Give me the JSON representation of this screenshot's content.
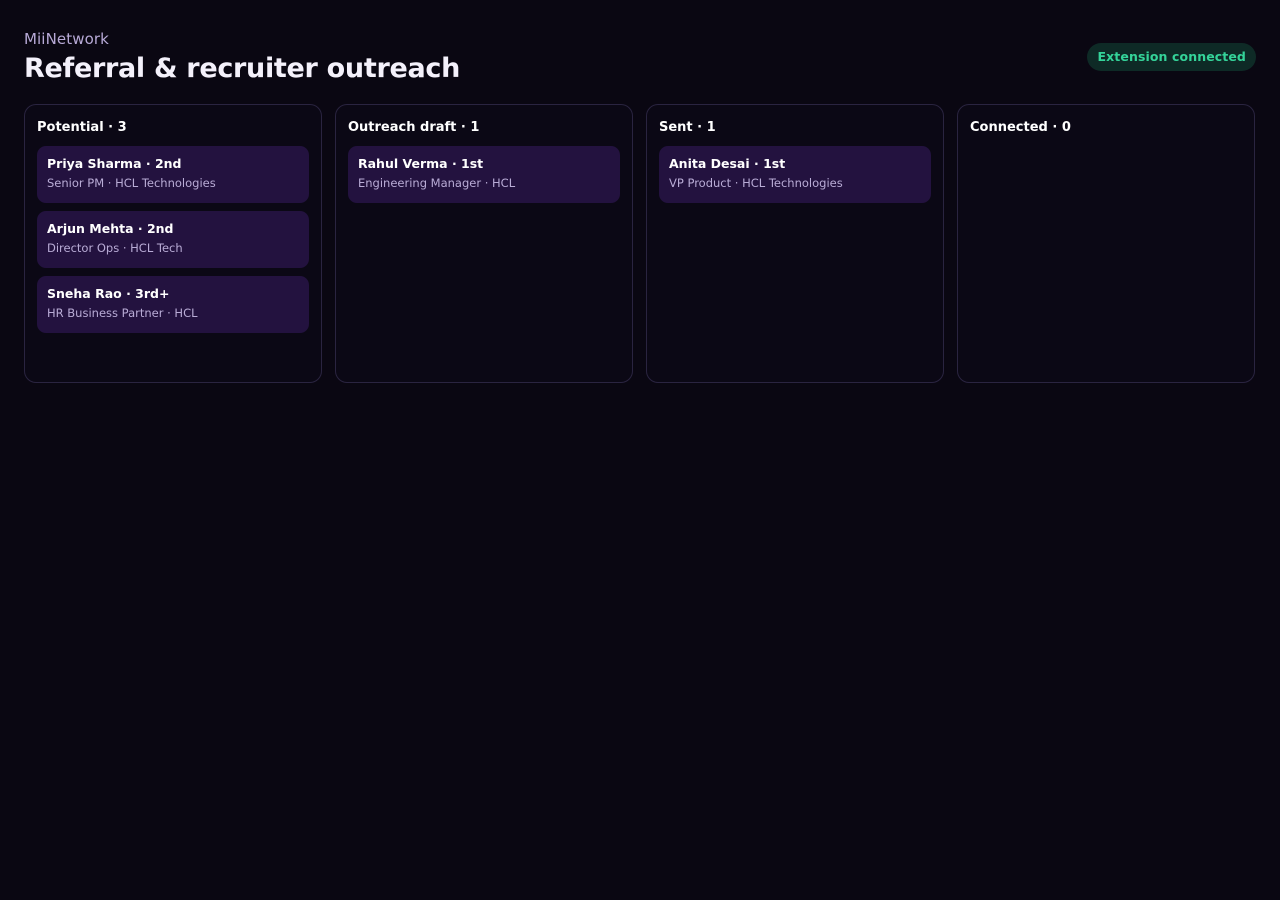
{
  "header": {
    "app_name": "MiiNetwork",
    "title": "Referral & recruiter outreach",
    "status": "Extension connected"
  },
  "colors": {
    "background": "#0a0712",
    "card": "#23123f",
    "column_border": "#2a2440",
    "status_text": "#34d399",
    "status_bg": "#0e2a26"
  },
  "columns": [
    {
      "title": "Potential · 3",
      "cards": [
        {
          "name": "Priya Sharma · 2nd",
          "role": "Senior PM · HCL Technologies"
        },
        {
          "name": "Arjun Mehta · 2nd",
          "role": "Director Ops · HCL Tech"
        },
        {
          "name": "Sneha Rao · 3rd+",
          "role": "HR Business Partner · HCL"
        }
      ]
    },
    {
      "title": "Outreach draft · 1",
      "cards": [
        {
          "name": "Rahul Verma · 1st",
          "role": "Engineering Manager · HCL"
        }
      ]
    },
    {
      "title": "Sent · 1",
      "cards": [
        {
          "name": "Anita Desai · 1st",
          "role": "VP Product · HCL Technologies"
        }
      ]
    },
    {
      "title": "Connected · 0",
      "cards": []
    }
  ]
}
